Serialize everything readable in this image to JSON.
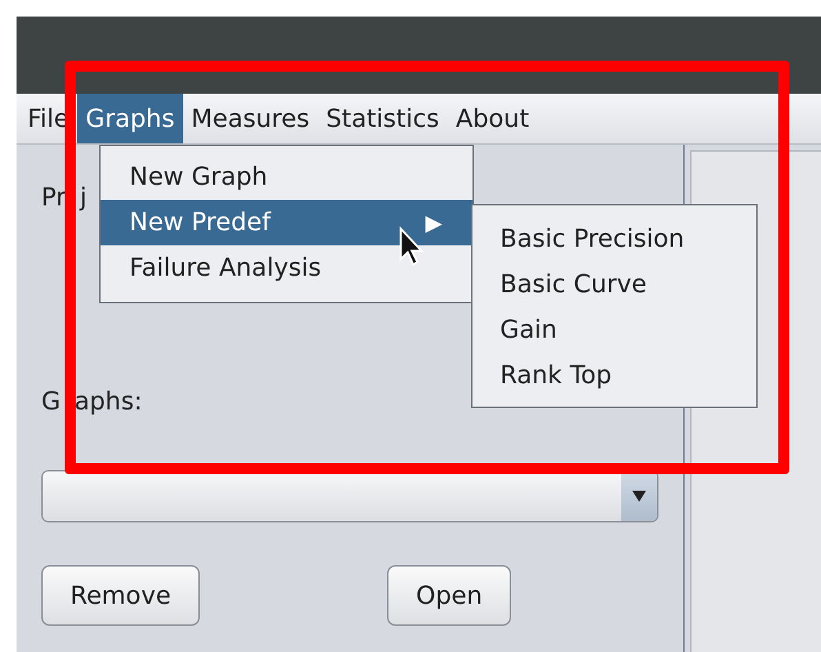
{
  "menubar": [
    {
      "label": "File",
      "selected": false
    },
    {
      "label": "Graphs",
      "selected": true
    },
    {
      "label": "Measures",
      "selected": false
    },
    {
      "label": "Statistics",
      "selected": false
    },
    {
      "label": "About",
      "selected": false
    }
  ],
  "panel": {
    "rows": [
      {
        "label_parts": [
          "Pr",
          "j"
        ]
      }
    ],
    "graphs_label_parts": [
      "G",
      "aphs:"
    ],
    "buttons": [
      "Remove",
      "Open"
    ]
  },
  "menu": {
    "items": [
      {
        "label": "New Graph",
        "selected": false,
        "submenu": false
      },
      {
        "label": "New Predef",
        "selected": true,
        "submenu": true
      },
      {
        "label": "Failure Analysis",
        "selected": false,
        "submenu": false
      }
    ],
    "arrow": "▶"
  },
  "submenu": {
    "items": [
      {
        "label": "Basic Precision",
        "selected": false
      },
      {
        "label": "Basic Curve",
        "selected": false
      },
      {
        "label": "Gain",
        "selected": false
      },
      {
        "label": "Rank Top",
        "selected": false
      }
    ]
  }
}
